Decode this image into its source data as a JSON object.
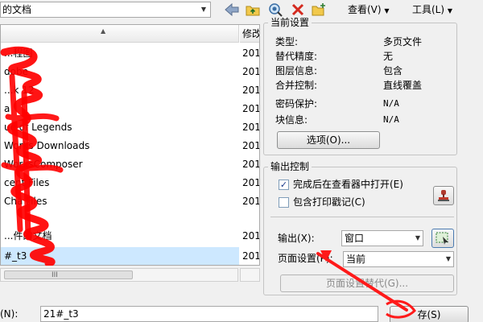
{
  "toolbar": {
    "location_text": "的文档",
    "view_menu": "查看(V)",
    "tools_menu": "工具(L)"
  },
  "file_list": {
    "date_header": "修改",
    "rows": [
      {
        "name": "...程图",
        "date": "201"
      },
      {
        "name": "dobe",
        "date": "201"
      },
      {
        "name": "...k 12",
        "date": "201"
      },
      {
        "name": "a",
        "date": "201"
      },
      {
        "name": "ue of Legends",
        "date": "201"
      },
      {
        "name": "Works Downloads",
        "date": "201"
      },
      {
        "name": "WorksComposer",
        "date": "201"
      },
      {
        "name": "cent Files",
        "date": "201"
      },
      {
        "name": "Cha Files",
        "date": "201"
      },
      {
        "name": "...件的文档",
        "date": "201"
      },
      {
        "name": "#_t3",
        "date": "201"
      }
    ],
    "hscroll_grip": "III"
  },
  "current_settings": {
    "title": "当前设置",
    "items": [
      {
        "label": "类型:",
        "value": "多页文件"
      },
      {
        "label": "替代精度:",
        "value": "无"
      },
      {
        "label": "图层信息:",
        "value": "包含"
      },
      {
        "label": "合并控制:",
        "value": "直线覆盖"
      },
      {
        "label": "密码保护:",
        "value": "N/A"
      },
      {
        "label": "块信息:",
        "value": "N/A"
      }
    ],
    "options_button": "选项(O)..."
  },
  "output_control": {
    "title": "输出控制",
    "open_in_viewer_label": "完成后在查看器中打开(E)",
    "open_in_viewer_checked": true,
    "include_stamp_label": "包含打印戳记(C)",
    "include_stamp_checked": false,
    "output_label": "输出(X):",
    "output_value": "窗口",
    "page_setup_label": "页面设置(P):",
    "page_setup_value": "当前",
    "page_setup_override_button": "页面设置替代(G)..."
  },
  "bottom": {
    "filename_label": "(N):",
    "filename_value": "21#_t3",
    "save_button": "存(S)"
  },
  "colors": {
    "scribble": "#ff0000",
    "arrow": "#ff1a1a"
  }
}
